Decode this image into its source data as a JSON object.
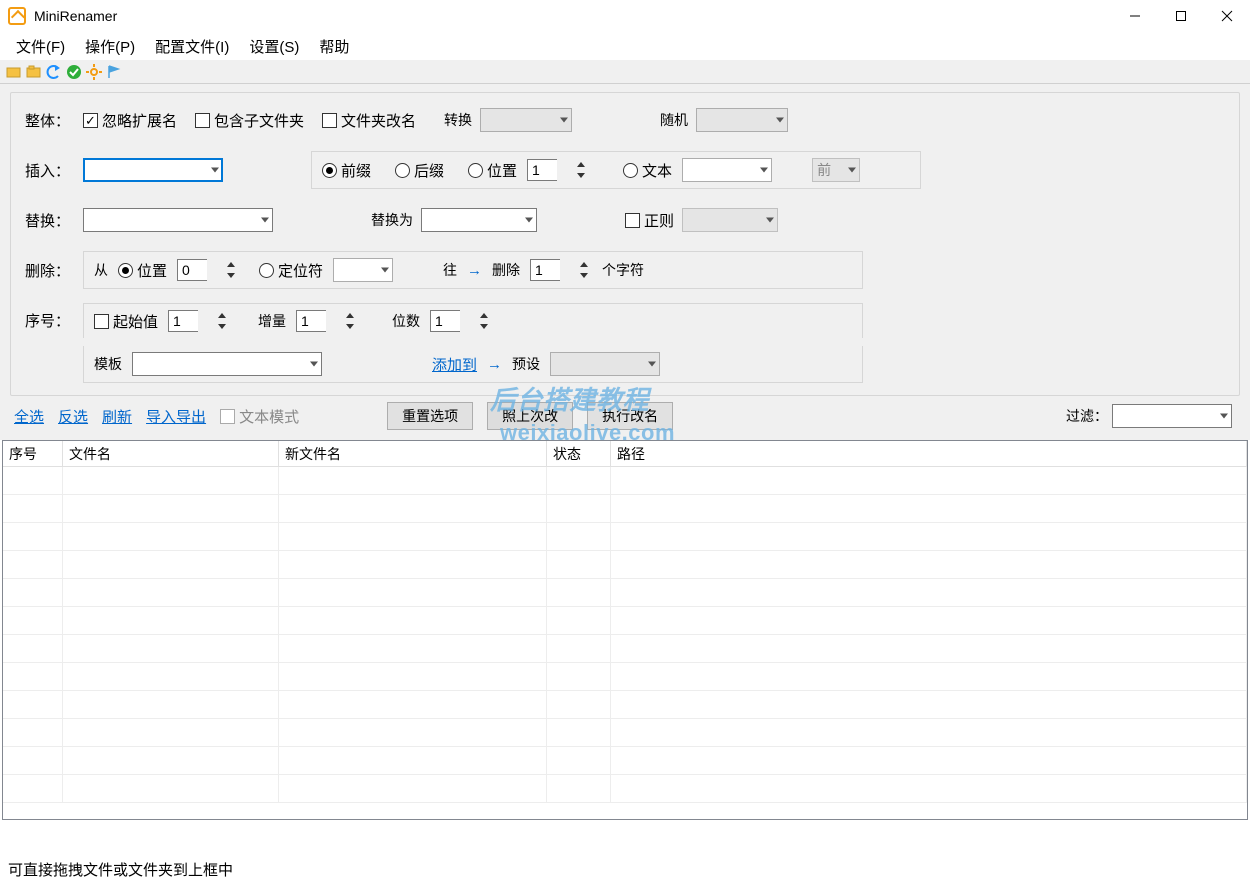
{
  "app": {
    "title": "MiniRenamer"
  },
  "menu": {
    "file": "文件(F)",
    "ops": "操作(P)",
    "profile": "配置文件(I)",
    "settings": "设置(S)",
    "help": "帮助"
  },
  "overall": {
    "label": "整体",
    "ignoreExt": "忽略扩展名",
    "includeSub": "包含子文件夹",
    "renameFolder": "文件夹改名",
    "convert": "转换",
    "random": "随机"
  },
  "insert": {
    "label": "插入",
    "prefix": "前缀",
    "suffix": "后缀",
    "position": "位置",
    "positionVal": "1",
    "text": "文本",
    "front": "前"
  },
  "replace": {
    "label": "替换",
    "replaceWith": "替换为",
    "regex": "正则"
  },
  "del": {
    "label": "删除",
    "from": "从",
    "position": "位置",
    "posVal": "0",
    "locator": "定位符",
    "towards": "往",
    "delete": "删除",
    "countVal": "1",
    "chars": "个字符"
  },
  "seq": {
    "label": "序号",
    "start": "起始值",
    "startVal": "1",
    "step": "增量",
    "stepVal": "1",
    "digits": "位数",
    "digitsVal": "1",
    "template": "模板",
    "addTo": "添加到",
    "preset": "预设"
  },
  "mid": {
    "selectAll": "全选",
    "invert": "反选",
    "refresh": "刷新",
    "importExport": "导入导出",
    "textMode": "文本模式",
    "reset": "重置选项",
    "lastTime": "照上次改",
    "execute": "执行改名",
    "filter": "过滤"
  },
  "table": {
    "seq": "序号",
    "filename": "文件名",
    "newname": "新文件名",
    "status": "状态",
    "path": "路径"
  },
  "status": {
    "hint": "可直接拖拽文件或文件夹到上框中"
  },
  "watermark": {
    "line1": "后台搭建教程",
    "line2": "weixiaolive.com"
  }
}
